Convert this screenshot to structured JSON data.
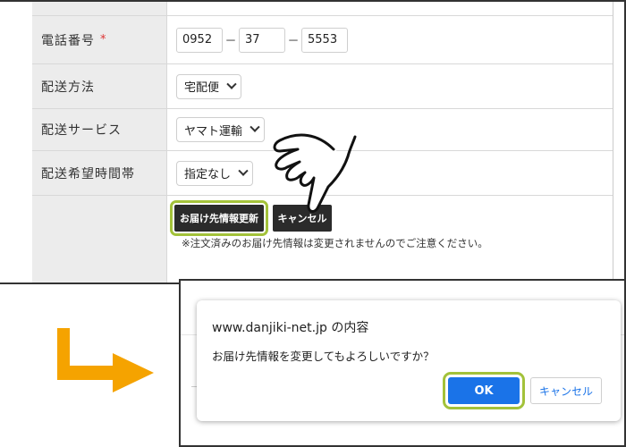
{
  "form": {
    "phone": {
      "label": "電話番号",
      "required_mark": "*",
      "part1": "0952",
      "separator": "－",
      "part2": "37",
      "part3": "5553"
    },
    "delivery_method": {
      "label": "配送方法",
      "value": "宅配便"
    },
    "delivery_service": {
      "label": "配送サービス",
      "value": "ヤマト運輸"
    },
    "delivery_time": {
      "label": "配送希望時間帯",
      "value": "指定なし"
    },
    "actions": {
      "update_label": "お届け先情報更新",
      "cancel_label": "キャンセル",
      "note": "※注文済みのお届け先情報は変更されませんのでご注意ください。"
    }
  },
  "dialog": {
    "title": "www.danjiki-net.jp の内容",
    "message": "お届け先情報を変更してもよろしいですか？",
    "ok_label": "OK",
    "cancel_label": "キャンセル"
  },
  "colors": {
    "highlight": "#a3c23a",
    "arrow": "#f5a300",
    "ok_button": "#1a73e8",
    "dark_button": "#2b2b2b"
  },
  "icons": [
    "pointing-hand-icon",
    "down-right-arrow-icon"
  ]
}
